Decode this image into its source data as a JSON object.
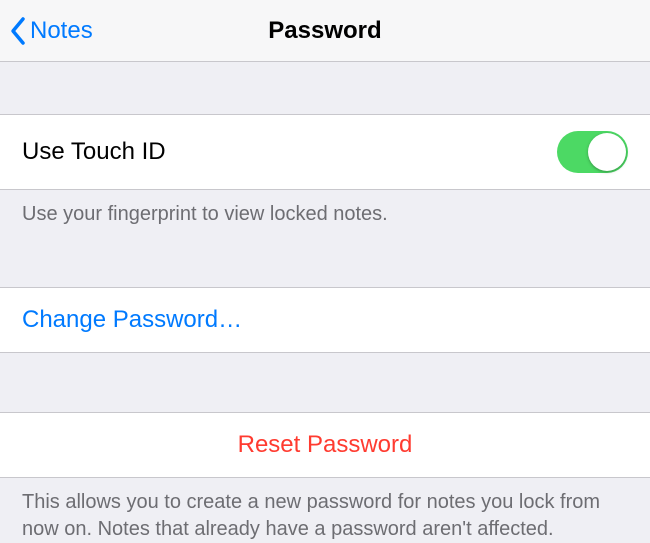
{
  "nav": {
    "back_label": "Notes",
    "title": "Password"
  },
  "touch_id": {
    "label": "Use Touch ID",
    "enabled": true,
    "footer": "Use your fingerprint to view locked notes."
  },
  "change_password": {
    "label": "Change Password…"
  },
  "reset_password": {
    "label": "Reset Password",
    "footer": "This allows you to create a new password for notes you lock from now on. Notes that already have a password aren't affected."
  },
  "colors": {
    "tint": "#007aff",
    "destructive": "#ff3b30",
    "toggle_on": "#4cd964",
    "background": "#efeff4"
  }
}
